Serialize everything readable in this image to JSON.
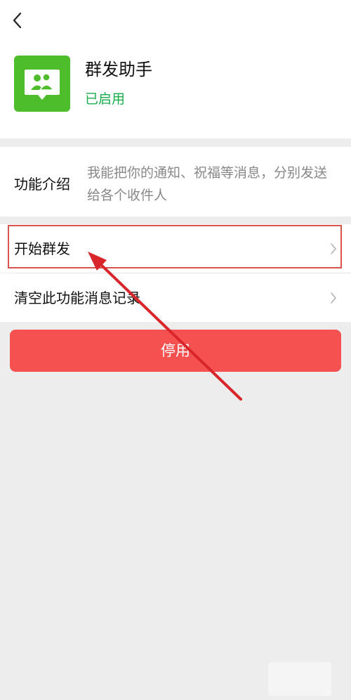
{
  "header": {
    "back_icon": "chevron-left-icon"
  },
  "app": {
    "icon": "group-broadcast-icon",
    "icon_color": "#4ebd2b",
    "name": "群发助手",
    "status": "已启用",
    "status_color": "#1aad4d"
  },
  "intro": {
    "label": "功能介绍",
    "text": "我能把你的通知、祝福等消息，分别发送给各个收件人"
  },
  "menu": {
    "items": [
      {
        "label": "开始群发",
        "icon": "chevron-right-icon"
      },
      {
        "label": "清空此功能消息记录",
        "icon": "chevron-right-icon"
      }
    ]
  },
  "actions": {
    "stop_label": "停用",
    "stop_color": "#f55150"
  },
  "annotation": {
    "highlight_color": "#d9534f",
    "arrow_color": "#d9262b"
  }
}
